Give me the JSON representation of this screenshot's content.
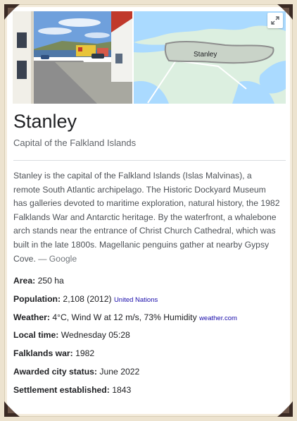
{
  "place": {
    "title": "Stanley",
    "subtitle": "Capital of the Falkland Islands"
  },
  "map": {
    "label": "Stanley"
  },
  "description": {
    "text": "Stanley is the capital of the Falkland Islands (Islas Malvinas), a remote South Atlantic archipelago. The Historic Dockyard Museum has galleries devoted to maritime exploration, natural history, the 1982 Falklands War and Antarctic heritage. By the waterfront, a whalebone arch stands near the entrance of Christ Church Cathedral, which was built in the late 1800s. Magellanic penguins gather at nearby Gypsy Cove.",
    "source": "— Google"
  },
  "facts": {
    "area": {
      "label": "Area:",
      "value": "250 ha"
    },
    "population": {
      "label": "Population:",
      "value": "2,108 (2012)",
      "source": "United Nations"
    },
    "weather": {
      "label": "Weather:",
      "value": "4°C, Wind W at 12 m/s, 73% Humidity",
      "source": "weather.com"
    },
    "local_time": {
      "label": "Local time:",
      "value": "Wednesday 05:28"
    },
    "falklands_war": {
      "label": "Falklands war:",
      "value": "1982"
    },
    "city_status": {
      "label": "Awarded city status:",
      "value": "June 2022"
    },
    "settlement": {
      "label": "Settlement established:",
      "value": "1843"
    }
  },
  "icons": {
    "expand": "expand-arrows-icon",
    "corners": "photo-corner-icon"
  },
  "colors": {
    "link": "#1a0dab",
    "title": "#202124",
    "text": "#4d5156",
    "map_water": "#aadaff",
    "map_land": "#dcefe0",
    "map_region": "#8d8d8d"
  }
}
